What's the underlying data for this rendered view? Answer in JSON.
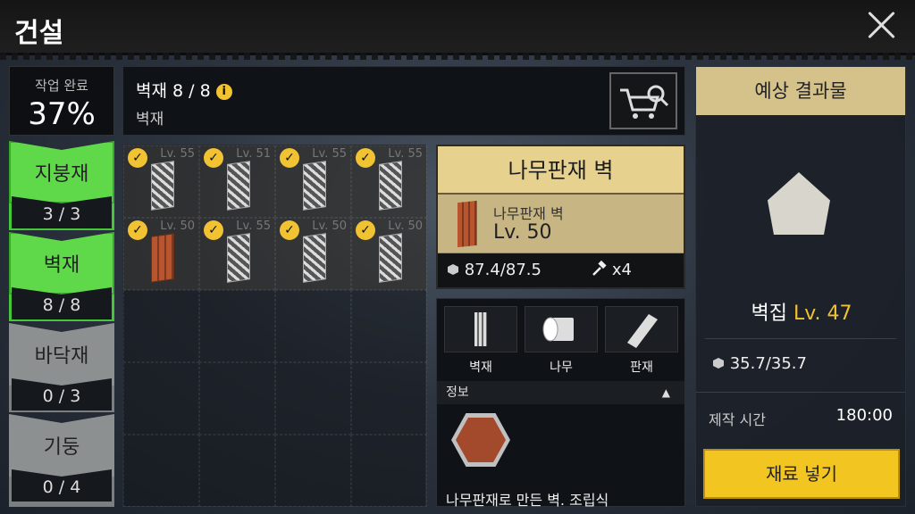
{
  "title": "건설",
  "progress": {
    "label": "작업 완료",
    "percent": "37%"
  },
  "categories": [
    {
      "name": "지붕재",
      "count": "3 / 3",
      "state": "complete"
    },
    {
      "name": "벽재",
      "count": "8 / 8",
      "state": "complete"
    },
    {
      "name": "바닥재",
      "count": "0 / 3",
      "state": "incomplete"
    },
    {
      "name": "기둥",
      "count": "0 / 4",
      "state": "incomplete"
    }
  ],
  "header": {
    "title": "벽재 8 / 8",
    "subtitle": "벽재",
    "info_icon": "info-icon",
    "cart_icon": "shop-search-icon"
  },
  "grid_items": [
    {
      "level": "Lv. 55",
      "checked": true
    },
    {
      "level": "Lv. 51",
      "checked": true
    },
    {
      "level": "Lv. 55",
      "checked": true
    },
    {
      "level": "Lv. 55",
      "checked": true
    },
    {
      "level": "Lv. 50",
      "checked": true,
      "material": "wood"
    },
    {
      "level": "Lv. 55",
      "checked": true
    },
    {
      "level": "Lv. 50",
      "checked": true
    },
    {
      "level": "Lv. 50",
      "checked": true
    }
  ],
  "detail": {
    "title": "나무판재 벽",
    "name": "나무판재 벽",
    "level": "Lv. 50",
    "durability": "87.4/87.5",
    "uses": "x4"
  },
  "materials": [
    {
      "label": "벽재"
    },
    {
      "label": "나무"
    },
    {
      "label": "판재"
    }
  ],
  "info_bar": {
    "label": "정보",
    "toggle": "▲"
  },
  "description": "나무판재로 만든 벽. 조립식",
  "result": {
    "header": "예상 결과물",
    "name": "벽집",
    "level": "Lv. 47",
    "durability": "35.7/35.7",
    "time_label": "제작 시간",
    "time_value": "180:00",
    "button": "재료 넣기"
  },
  "colors": {
    "accent": "#f3c521",
    "complete": "#5fd84a",
    "incomplete": "#8d9091",
    "panel_header": "#d5c18a"
  }
}
